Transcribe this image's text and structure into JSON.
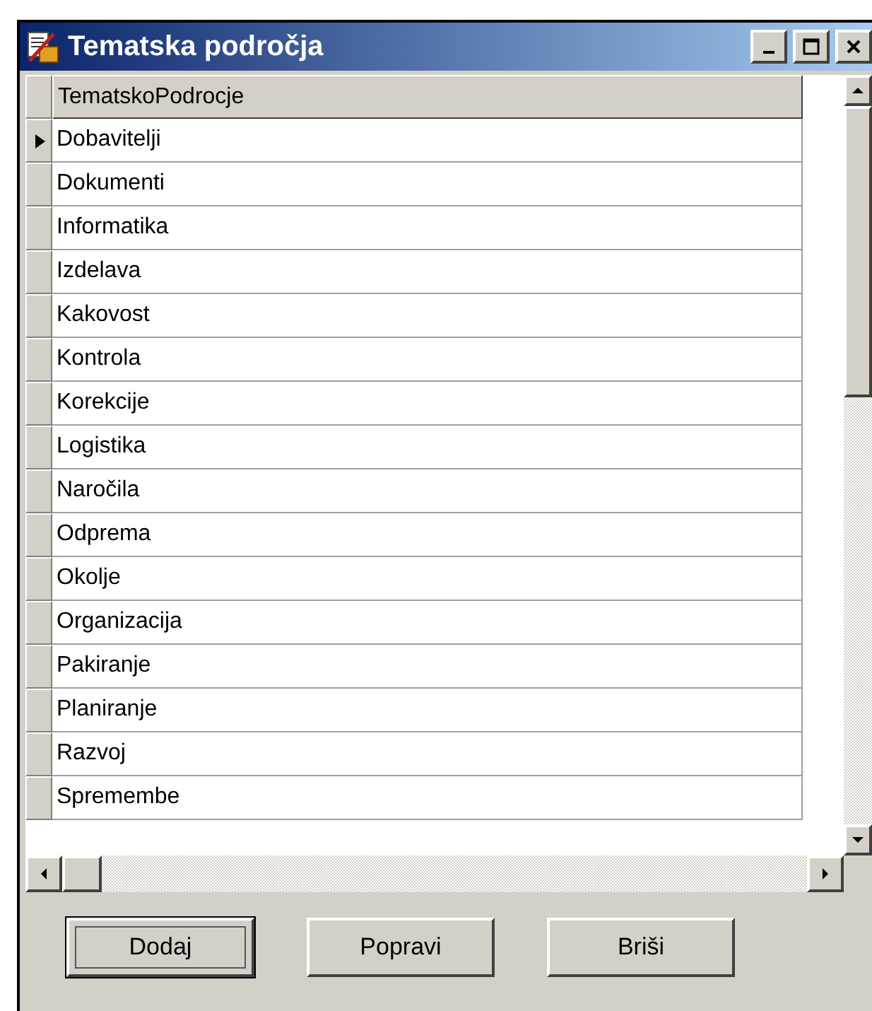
{
  "window": {
    "title": "Tematska področja"
  },
  "title_buttons": [
    {
      "kind": "minimize"
    },
    {
      "kind": "maximize"
    },
    {
      "kind": "close"
    }
  ],
  "table": {
    "columns": [
      "TematskoPodrocje"
    ],
    "rows": [
      {
        "value": "Dobavitelji",
        "selected": true
      },
      {
        "value": "Dokumenti",
        "selected": false
      },
      {
        "value": "Informatika",
        "selected": false
      },
      {
        "value": "Izdelava",
        "selected": false
      },
      {
        "value": "Kakovost",
        "selected": false
      },
      {
        "value": "Kontrola",
        "selected": false
      },
      {
        "value": "Korekcije",
        "selected": false
      },
      {
        "value": "Logistika",
        "selected": false
      },
      {
        "value": "Naročila",
        "selected": false
      },
      {
        "value": "Odprema",
        "selected": false
      },
      {
        "value": "Okolje",
        "selected": false
      },
      {
        "value": "Organizacija",
        "selected": false
      },
      {
        "value": "Pakiranje",
        "selected": false
      },
      {
        "value": "Planiranje",
        "selected": false
      },
      {
        "value": "Razvoj",
        "selected": false
      },
      {
        "value": "Spremembe",
        "selected": false
      }
    ]
  },
  "buttons": [
    {
      "label": "Dodaj",
      "focused": true
    },
    {
      "label": "Popravi",
      "focused": false
    },
    {
      "label": "Briši",
      "focused": false
    }
  ]
}
